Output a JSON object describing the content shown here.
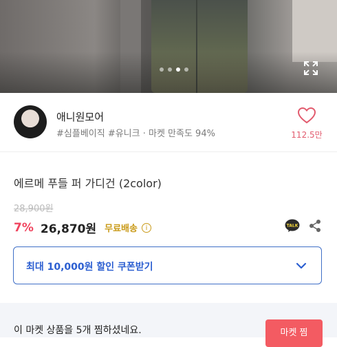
{
  "hero": {
    "slide_count": 4,
    "active_slide": 3
  },
  "seller": {
    "name": "애니원모어",
    "tags": "#심플베이직 #유니크 · 마켓 만족도 94%",
    "like_count": "112.5만"
  },
  "product": {
    "name": "에르메 푸들 퍼 가디건 (2color)",
    "original_price": "28,900원",
    "discount": "7%",
    "price": "26,870원",
    "shipping": "무료배송"
  },
  "coupon": {
    "label": "최대 10,000원 할인 쿠폰받기"
  },
  "bottom": {
    "zzim_text": "이 마켓 상품을 5개 찜하셨네요.",
    "button_label": "마켓 찜"
  },
  "colors": {
    "accent": "#f0455f",
    "coupon_blue": "#2c5fd1",
    "shipping_gold": "#c99a18"
  }
}
